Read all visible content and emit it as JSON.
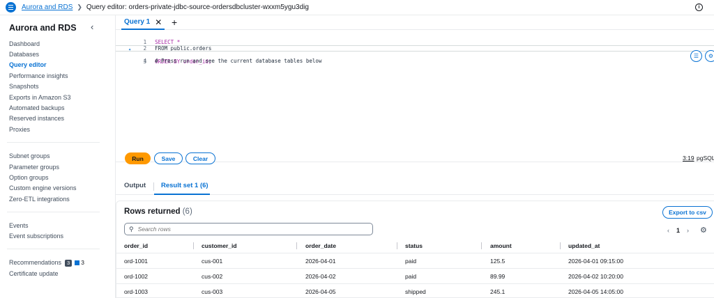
{
  "breadcrumb": {
    "root": "Aurora and RDS",
    "current": "Query editor: orders-private-jdbc-source-ordersdbcluster-wxxm5ygu3dig"
  },
  "sidebar": {
    "title": "Aurora and RDS",
    "group1": [
      "Dashboard",
      "Databases",
      "Query editor",
      "Performance insights",
      "Snapshots",
      "Exports in Amazon S3",
      "Automated backups",
      "Reserved instances",
      "Proxies"
    ],
    "group2": [
      "Subnet groups",
      "Parameter groups",
      "Option groups",
      "Custom engine versions",
      "Zero-ETL integrations"
    ],
    "group3": [
      "Events",
      "Event subscriptions"
    ],
    "recommendations": {
      "label": "Recommendations",
      "badge_dark": "3",
      "badge_blue": "3"
    },
    "certificate": "Certificate update",
    "active_item": "Query editor"
  },
  "query_tabs": [
    {
      "label": "Query 1"
    }
  ],
  "editor": {
    "lines": [
      {
        "num": "1",
        "text": "SELECT *"
      },
      {
        "num": "2",
        "text": "FROM public.orders"
      },
      {
        "num": "3",
        "text": "ORDER BY order_id;"
      },
      {
        "num": "4",
        "text": "# Press run and see the current database tables below"
      }
    ],
    "cursor_position": "3:19",
    "language": "pgSQL"
  },
  "actions": {
    "run": "Run",
    "save": "Save",
    "clear": "Clear"
  },
  "result_tabs": {
    "output": "Output",
    "result_set": "Result set 1 (6)"
  },
  "results": {
    "title": "Rows returned",
    "count": "(6)",
    "export_label": "Export to csv",
    "search_placeholder": "Search rows",
    "page": "1",
    "columns": [
      "order_id",
      "customer_id",
      "order_date",
      "status",
      "amount",
      "updated_at"
    ],
    "rows": [
      [
        "ord-1001",
        "cus-001",
        "2026-04-01",
        "paid",
        "125.5",
        "2026-04-01 09:15:00"
      ],
      [
        "ord-1002",
        "cus-002",
        "2026-04-02",
        "paid",
        "89.99",
        "2026-04-02 10:20:00"
      ],
      [
        "ord-1003",
        "cus-003",
        "2026-04-05",
        "shipped",
        "245.1",
        "2026-04-05 14:05:00"
      ]
    ]
  },
  "colors": {
    "accent": "#0972d3",
    "run_button": "#ff9900",
    "keyword": "#a626a4"
  }
}
